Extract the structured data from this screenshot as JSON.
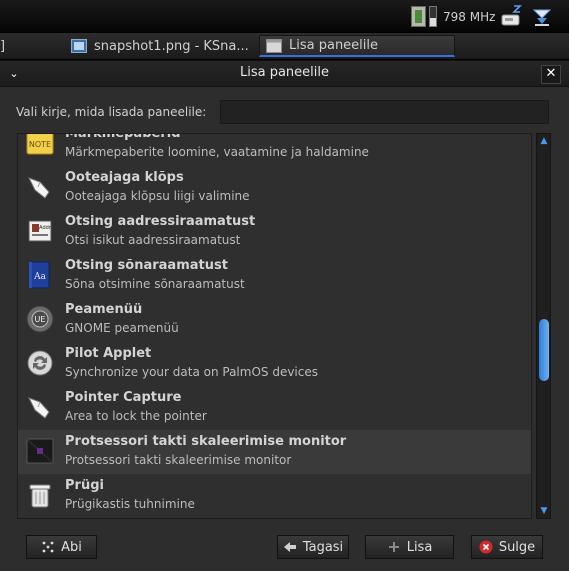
{
  "top_panel": {
    "cpu_frequency": "798 MHz",
    "tray_icons": [
      "cpu-freq-icon",
      "update-notifier-icon",
      "network-icon"
    ]
  },
  "taskbar": {
    "tasks": [
      {
        "label": "]",
        "icon": "window-icon"
      },
      {
        "label": "snapshot1.png - KSna...",
        "icon": "ksnapshot-icon"
      },
      {
        "label": "Lisa paneelile",
        "icon": "window-icon",
        "active": true
      }
    ]
  },
  "dialog": {
    "title": "Lisa paneelile",
    "menu_glyph": "⌄",
    "close_glyph": "✕",
    "search_label": "Vali kirje, mida lisada paneelile:",
    "search_value": "",
    "items": [
      {
        "name": "Märkmepaberid",
        "desc": "Märkmepaberite loomine, vaatamine ja haldamine",
        "icon": "sticky-notes-icon"
      },
      {
        "name": "Ooteajaga klõps",
        "desc": "Ooteajaga klõpsu liigi valimine",
        "icon": "dwell-click-icon"
      },
      {
        "name": "Otsing aadressiraamatust",
        "desc": "Otsi isikut aadressiraamatust",
        "icon": "address-book-icon",
        "icon_text": "Addr"
      },
      {
        "name": "Otsing sõnaraamatust",
        "desc": "Sõna otsimine sõnaraamatust",
        "icon": "dictionary-icon",
        "icon_text": "Aa"
      },
      {
        "name": "Peamenüü",
        "desc": "GNOME peamenüü",
        "icon": "main-menu-icon",
        "icon_text": "UE"
      },
      {
        "name": "Pilot Applet",
        "desc": "Synchronize your data on PalmOS devices",
        "icon": "pilot-applet-icon"
      },
      {
        "name": "Pointer Capture",
        "desc": "Area to lock the pointer",
        "icon": "pointer-capture-icon"
      },
      {
        "name": "Protsessori takti skaleerimise monitor",
        "desc": "Protsessori takti skaleerimise monitor",
        "icon": "cpu-scaling-icon",
        "selected": true
      },
      {
        "name": "Prügi",
        "desc": "Prügikastis tuhnimine",
        "icon": "trash-icon"
      }
    ],
    "scroll": {
      "up_glyph": "▲",
      "down_glyph": "▼",
      "position_fraction": 0.58
    },
    "buttons": {
      "help": "Abi",
      "back": "Tagasi",
      "add": "Lisa",
      "close": "Sulge"
    }
  }
}
